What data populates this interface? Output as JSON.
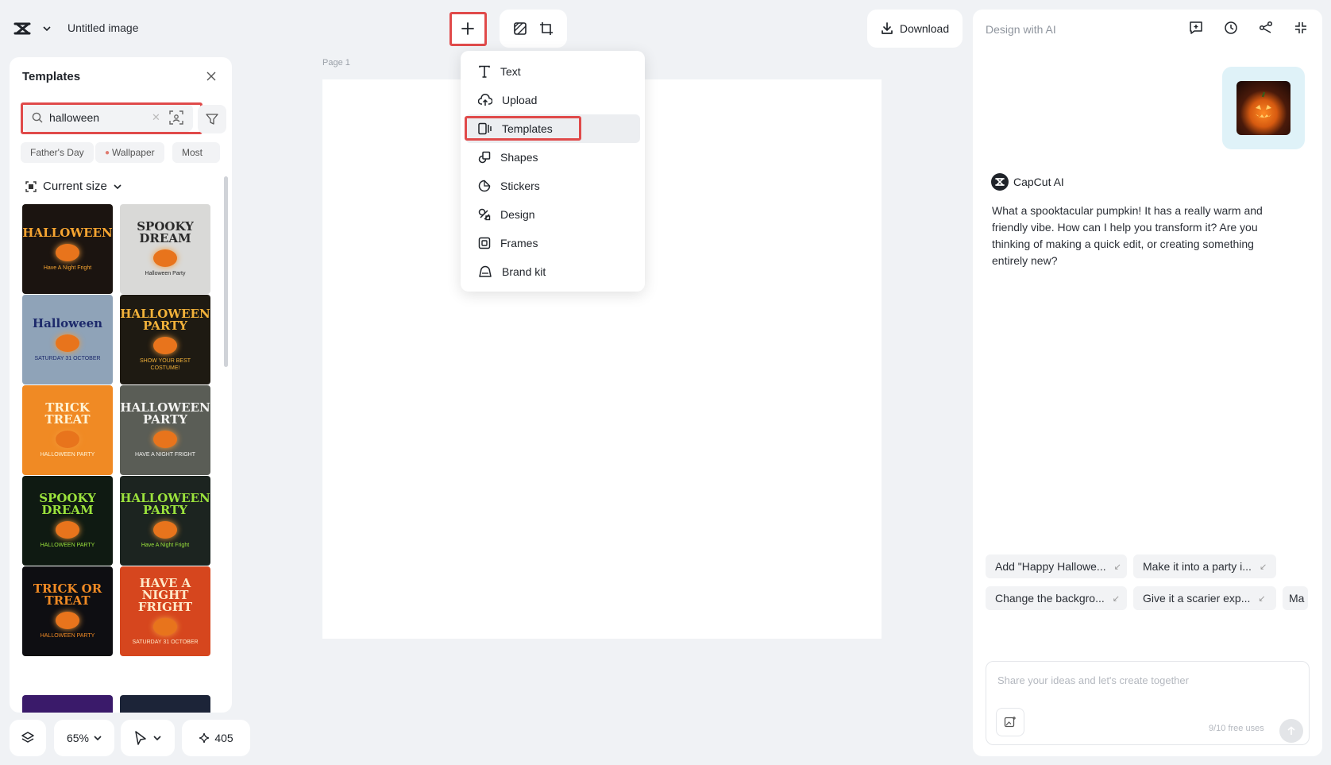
{
  "topbar": {
    "title": "Untitled image",
    "download_label": "Download"
  },
  "templates_panel": {
    "title": "Templates",
    "search_value": "halloween",
    "chips": [
      "Father's Day",
      "Wallpaper",
      "Most"
    ],
    "size_selector": "Current size",
    "templates": [
      {
        "t1": "HALLOWEEN",
        "t2": "Have A Night Fright",
        "bg": "#1b1410",
        "fg": "#f7a531"
      },
      {
        "t1": "SPOOKY DREAM",
        "t2": "Halloween Party",
        "bg": "#d9d9d7",
        "fg": "#2a2a2a"
      },
      {
        "t1": "Halloween",
        "t2": "SATURDAY 31 OCTOBER",
        "bg": "#8fa3b8",
        "fg": "#1d2a6b"
      },
      {
        "t1": "HALLOWEEN PARTY",
        "t2": "SHOW YOUR BEST COSTUME!",
        "bg": "#1e1a12",
        "fg": "#f2b23a"
      },
      {
        "t1": "TRICK TREAT",
        "t2": "HALLOWEEN PARTY",
        "bg": "#f08a24",
        "fg": "#fff4d6"
      },
      {
        "t1": "HALLOWEEN PARTY",
        "t2": "HAVE A NIGHT FRIGHT",
        "bg": "#5a5d56",
        "fg": "#f2f2f0"
      },
      {
        "t1": "SPOOKY DREAM",
        "t2": "HALLOWEEN PARTY",
        "bg": "#0f1a12",
        "fg": "#9be23c"
      },
      {
        "t1": "HALLOWEEN PARTY",
        "t2": "Have A Night Fright",
        "bg": "#1c2420",
        "fg": "#9be23c"
      },
      {
        "t1": "TRICK OR TREAT",
        "t2": "HALLOWEEN PARTY",
        "bg": "#0e0e12",
        "fg": "#f08a24"
      },
      {
        "t1": "HAVE A NIGHT FRIGHT",
        "t2": "SATURDAY 31 OCTOBER",
        "bg": "#d6461e",
        "fg": "#ffe8c8"
      }
    ]
  },
  "bottom_controls": {
    "zoom": "65%",
    "credits": "405"
  },
  "canvas": {
    "page_label": "Page 1"
  },
  "add_menu": {
    "items": [
      {
        "label": "Text",
        "icon": "text-icon"
      },
      {
        "label": "Upload",
        "icon": "upload-icon"
      },
      {
        "label": "Templates",
        "icon": "templates-icon"
      },
      {
        "label": "Shapes",
        "icon": "shapes-icon"
      },
      {
        "label": "Stickers",
        "icon": "stickers-icon"
      },
      {
        "label": "Design",
        "icon": "design-icon"
      },
      {
        "label": "Frames",
        "icon": "frames-icon"
      },
      {
        "label": "Brand kit",
        "icon": "brand-kit-icon"
      }
    ],
    "active_index": 2
  },
  "ai_panel": {
    "title": "Design with AI",
    "sender": "CapCut AI",
    "message": "What a spooktacular pumpkin! It has a really warm and friendly vibe. How can I help you transform it? Are you thinking of making a quick edit, or creating something entirely new?",
    "suggestions": [
      "Add \"Happy Hallowe...",
      "Make it into a party i...",
      "Change the backgro...",
      "Give it a scarier exp...",
      "Ma"
    ],
    "prompt_placeholder": "Share your ideas and let's create together",
    "free_uses": "9/10 free uses"
  },
  "colors": {
    "highlight": "#e04a4a",
    "app_bg": "#f0f2f5"
  }
}
